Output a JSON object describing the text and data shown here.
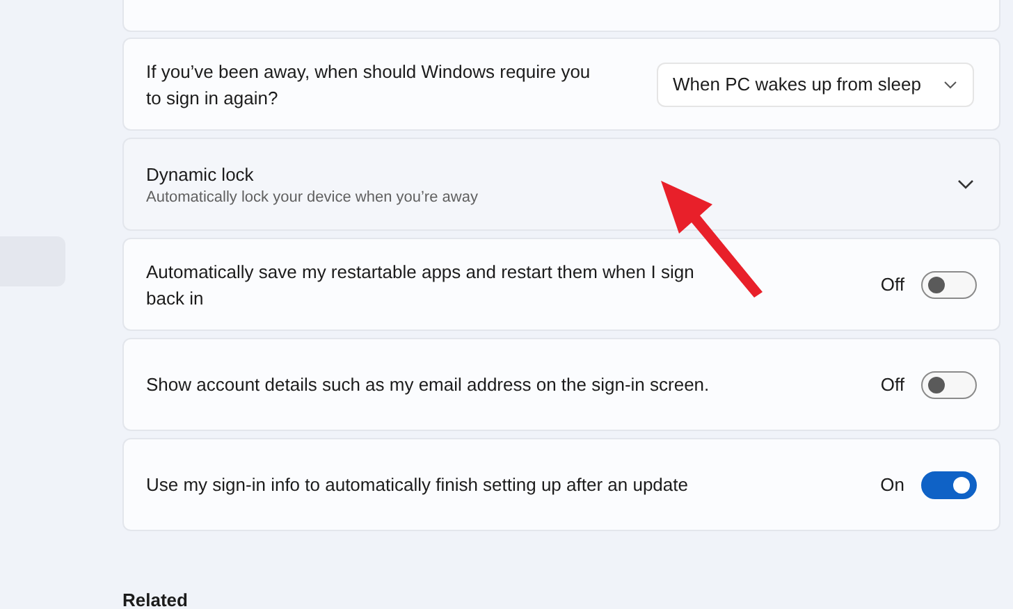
{
  "sidebar": {
    "items": [
      {
        "selected": true
      }
    ]
  },
  "settings": [
    {
      "kind": "dropdown",
      "label": "If you’ve been away, when should Windows require you to sign in again?",
      "value": "When PC wakes up from sleep"
    },
    {
      "kind": "expander",
      "label": "Dynamic lock",
      "description": "Automatically lock your device when you’re away",
      "expanded": false,
      "hovered": true
    },
    {
      "kind": "toggle",
      "label": "Automatically save my restartable apps and restart them when I sign back in",
      "state_text": "Off",
      "on": false
    },
    {
      "kind": "toggle",
      "label": "Show account details such as my email address on the sign-in screen.",
      "state_text": "Off",
      "on": false
    },
    {
      "kind": "toggle",
      "label": "Use my sign-in info to automatically finish setting up after an update",
      "state_text": "On",
      "on": true
    }
  ],
  "related": {
    "heading": "Related"
  }
}
